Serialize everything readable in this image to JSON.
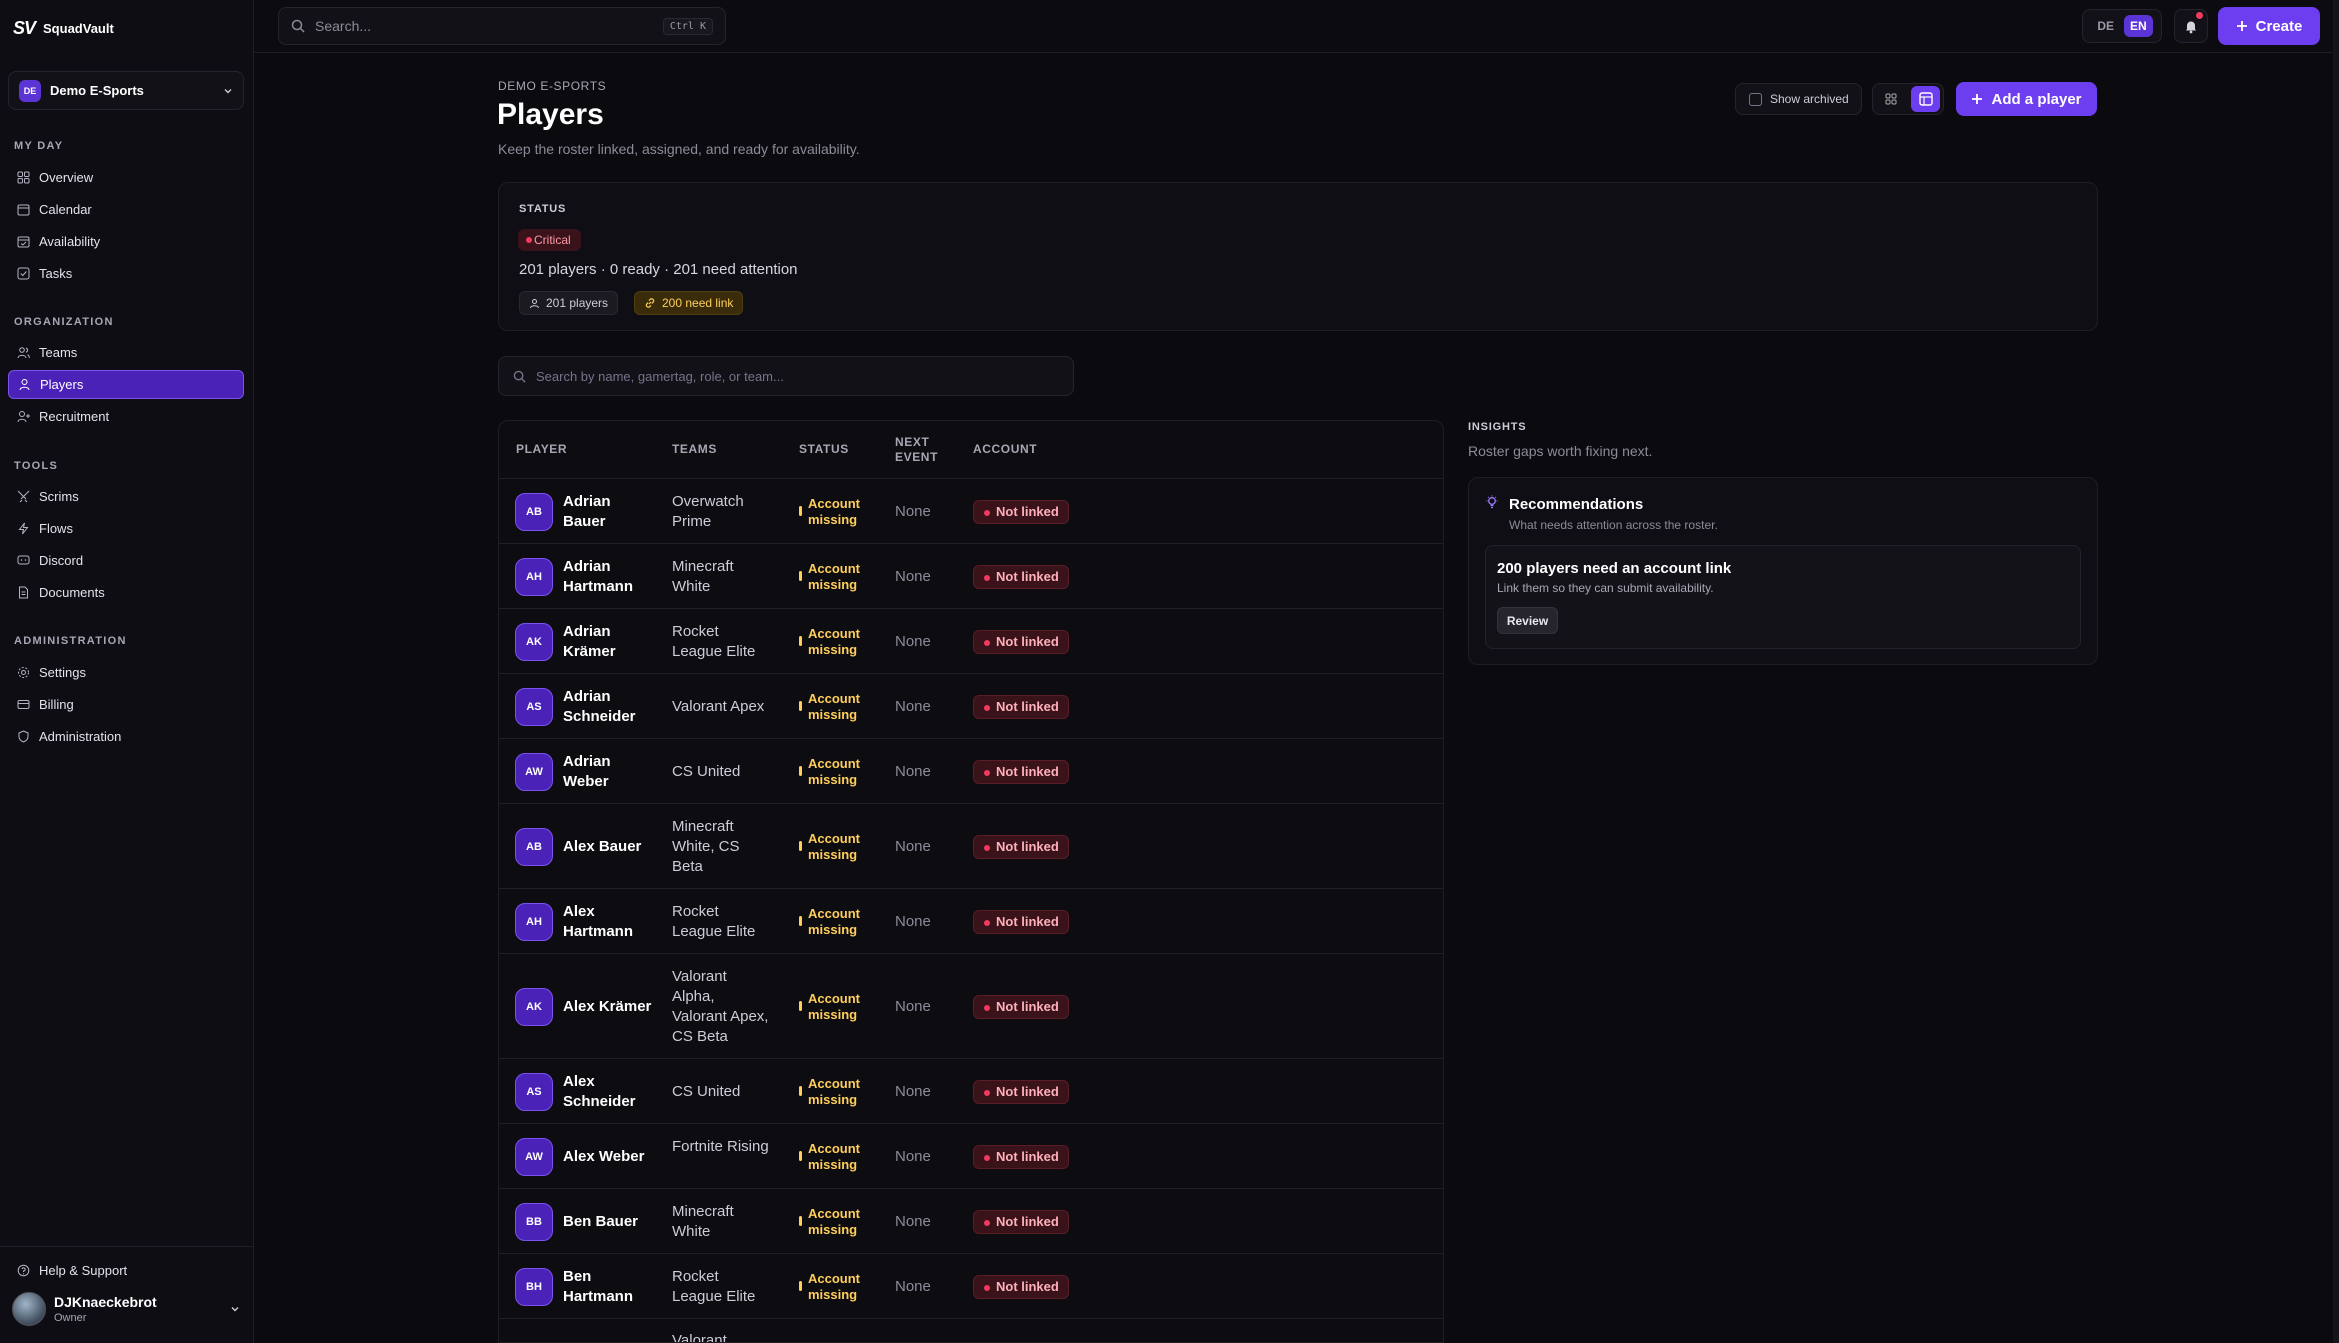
{
  "brand": {
    "mark": "SV",
    "name": "SquadVault"
  },
  "org": {
    "badge": "DE",
    "name": "Demo E-Sports"
  },
  "sidebar": {
    "sections": [
      {
        "title": "MY DAY",
        "items": [
          {
            "label": "Overview",
            "icon": "grid-icon"
          },
          {
            "label": "Calendar",
            "icon": "calendar-icon"
          },
          {
            "label": "Availability",
            "icon": "calendar-check-icon"
          },
          {
            "label": "Tasks",
            "icon": "checkbox-icon"
          }
        ]
      },
      {
        "title": "ORGANIZATION",
        "items": [
          {
            "label": "Teams",
            "icon": "users-icon"
          },
          {
            "label": "Players",
            "icon": "user-icon",
            "active": true
          },
          {
            "label": "Recruitment",
            "icon": "user-plus-icon"
          }
        ]
      },
      {
        "title": "TOOLS",
        "items": [
          {
            "label": "Scrims",
            "icon": "swords-icon"
          },
          {
            "label": "Flows",
            "icon": "bolt-icon"
          },
          {
            "label": "Discord",
            "icon": "chat-icon"
          },
          {
            "label": "Documents",
            "icon": "file-icon"
          }
        ]
      },
      {
        "title": "ADMINISTRATION",
        "items": [
          {
            "label": "Settings",
            "icon": "gear-icon"
          },
          {
            "label": "Billing",
            "icon": "card-icon"
          },
          {
            "label": "Administration",
            "icon": "shield-icon"
          }
        ]
      }
    ],
    "help_label": "Help & Support",
    "user": {
      "name": "DJKnaeckebrot",
      "role": "Owner"
    }
  },
  "topbar": {
    "search_placeholder": "Search...",
    "shortcut": "Ctrl K",
    "lang": [
      "DE",
      "EN"
    ],
    "lang_active": "EN",
    "create_label": "Create"
  },
  "page": {
    "eyebrow": "DEMO E-SPORTS",
    "title": "Players",
    "subtitle": "Keep the roster linked, assigned, and ready for availability.",
    "show_archived": "Show archived",
    "add_label": "Add a player"
  },
  "status": {
    "label": "STATUS",
    "badge": "Critical",
    "summary": "201 players · 0 ready · 201 need attention",
    "pill_players": "201 players",
    "pill_link": "200 need link"
  },
  "search_players_placeholder": "Search by name, gamertag, role, or team...",
  "table": {
    "headers": {
      "player": "PLAYER",
      "teams": "TEAMS",
      "status": "STATUS",
      "next": "NEXT EVENT",
      "account": "ACCOUNT"
    },
    "rows": [
      {
        "initials": "AB",
        "name": "Adrian Bauer",
        "teams": "Overwatch Prime",
        "status": "Account missing",
        "next": "None",
        "account": "Not linked"
      },
      {
        "initials": "AH",
        "name": "Adrian Hartmann",
        "teams": "Minecraft White",
        "status": "Account missing",
        "next": "None",
        "account": "Not linked"
      },
      {
        "initials": "AK",
        "name": "Adrian Krämer",
        "teams": "Rocket League Elite",
        "status": "Account missing",
        "next": "None",
        "account": "Not linked"
      },
      {
        "initials": "AS",
        "name": "Adrian Schneider",
        "teams": "Valorant Apex",
        "status": "Account missing",
        "next": "None",
        "account": "Not linked"
      },
      {
        "initials": "AW",
        "name": "Adrian Weber",
        "teams": "CS United",
        "status": "Account missing",
        "next": "None",
        "account": "Not linked"
      },
      {
        "initials": "AB",
        "name": "Alex Bauer",
        "teams": "Minecraft White, CS Beta",
        "status": "Account missing",
        "next": "None",
        "account": "Not linked"
      },
      {
        "initials": "AH",
        "name": "Alex Hartmann",
        "teams": "Rocket League Elite",
        "status": "Account missing",
        "next": "None",
        "account": "Not linked"
      },
      {
        "initials": "AK",
        "name": "Alex Krämer",
        "teams": "Valorant Alpha, Valorant Apex, CS Beta",
        "status": "Account missing",
        "next": "None",
        "account": "Not linked"
      },
      {
        "initials": "AS",
        "name": "Alex Schneider",
        "teams": "CS United",
        "status": "Account missing",
        "next": "None",
        "account": "Not linked"
      },
      {
        "initials": "AW",
        "name": "Alex Weber",
        "teams": "Fortnite Rising",
        "status": "Account missing",
        "next": "None",
        "account": "Not linked"
      },
      {
        "initials": "BB",
        "name": "Ben Bauer",
        "teams": "Minecraft White",
        "status": "Account missing",
        "next": "None",
        "account": "Not linked"
      },
      {
        "initials": "BH",
        "name": "Ben Hartmann",
        "teams": "Rocket League Elite",
        "status": "Account missing",
        "next": "None",
        "account": "Not linked"
      },
      {
        "initials": "",
        "name": "",
        "teams": "Valorant",
        "status": "",
        "next": "",
        "account": ""
      }
    ]
  },
  "insights": {
    "label": "INSIGHTS",
    "subtitle": "Roster gaps worth fixing next.",
    "rec_title": "Recommendations",
    "rec_sub": "What needs attention across the roster.",
    "item_title": "200 players need an account link",
    "item_sub": "Link them so they can submit availability.",
    "review_label": "Review"
  }
}
